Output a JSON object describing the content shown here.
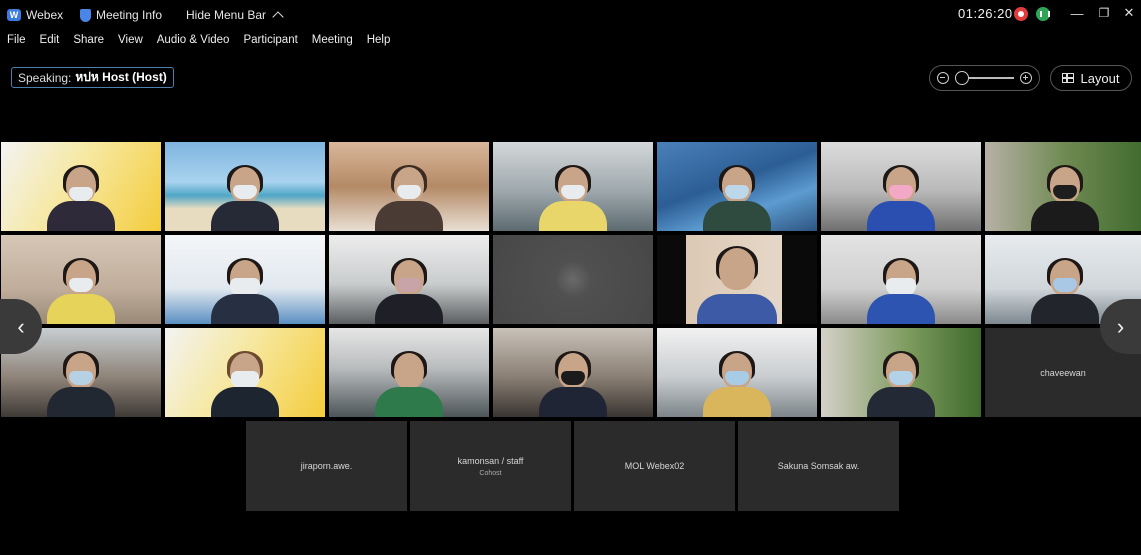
{
  "titlebar": {
    "app_name": "Webex",
    "meeting_info": "Meeting Info",
    "hide_menu": "Hide Menu Bar",
    "clock": "01:26:20"
  },
  "menubar": [
    "File",
    "Edit",
    "Share",
    "View",
    "Audio & Video",
    "Participant",
    "Meeting",
    "Help"
  ],
  "speaking": {
    "label": "Speaking:",
    "name": "หปห Host (Host)"
  },
  "layout_button": "Layout",
  "name_tiles": [
    {
      "name": "chaveewan",
      "sub": ""
    },
    {
      "name": "jiraporn.awe.",
      "sub": ""
    },
    {
      "name": "kamonsan / staff",
      "sub": "Cohost"
    },
    {
      "name": "MOL Webex02",
      "sub": ""
    },
    {
      "name": "Sakuna Somsak aw.",
      "sub": ""
    }
  ],
  "colors": {
    "accent": "#4a86e8",
    "record": "#e03c3c",
    "network": "#2fa55a"
  }
}
